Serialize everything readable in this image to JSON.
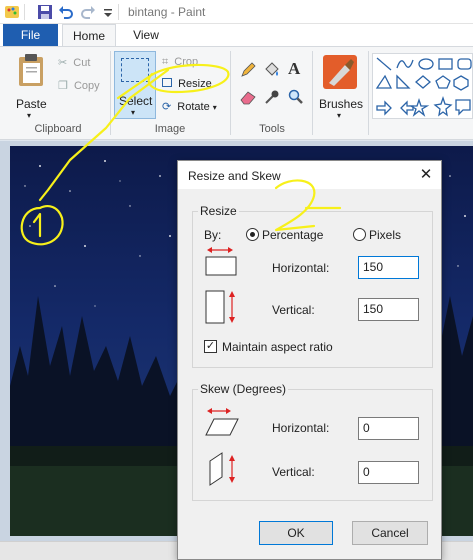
{
  "window": {
    "title": "bintang - Paint"
  },
  "ribbon": {
    "tabs": {
      "file": "File",
      "home": "Home",
      "view": "View"
    },
    "clipboard": {
      "paste": "Paste",
      "cut": "Cut",
      "copy": "Copy",
      "group": "Clipboard"
    },
    "image": {
      "select": "Select",
      "crop": "Crop",
      "resize": "Resize",
      "rotate": "Rotate",
      "group": "Image"
    },
    "tools": {
      "group": "Tools",
      "text_icon": "A"
    },
    "brushes": {
      "label": "Brushes"
    }
  },
  "dialog": {
    "title": "Resize and Skew",
    "close": "✕",
    "resize": {
      "legend": "Resize",
      "by_label": "By:",
      "percentage": "Percentage",
      "pixels": "Pixels",
      "horizontal_label": "Horizontal:",
      "horizontal_value": "150",
      "vertical_label": "Vertical:",
      "vertical_value": "150",
      "maintain": "Maintain aspect ratio",
      "maintain_checked": true
    },
    "skew": {
      "legend": "Skew (Degrees)",
      "horizontal_label": "Horizontal:",
      "horizontal_value": "0",
      "vertical_label": "Vertical:",
      "vertical_value": "0"
    },
    "ok": "OK",
    "cancel": "Cancel"
  },
  "colors": {
    "accent": "#1f5eb0",
    "annotation": "#f7f01a",
    "focus": "#0078d7"
  }
}
